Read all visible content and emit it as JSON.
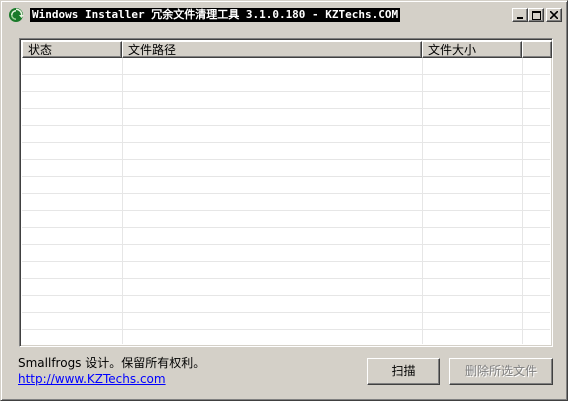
{
  "window": {
    "title": "Windows Installer 冗余文件清理工具 3.1.0.180 - KZTechs.COM"
  },
  "list": {
    "columns": [
      "状态",
      "文件路径",
      "文件大小",
      ""
    ],
    "rows": []
  },
  "footer": {
    "copyright": "Smallfrogs 设计。保留所有权利。",
    "link": "http://www.KZTechs.com"
  },
  "buttons": {
    "scan": "扫描",
    "delete_selected": "删除所选文件"
  },
  "colors": {
    "face": "#d4d0c8",
    "link": "#0000ff",
    "disabled_text": "#808080"
  }
}
